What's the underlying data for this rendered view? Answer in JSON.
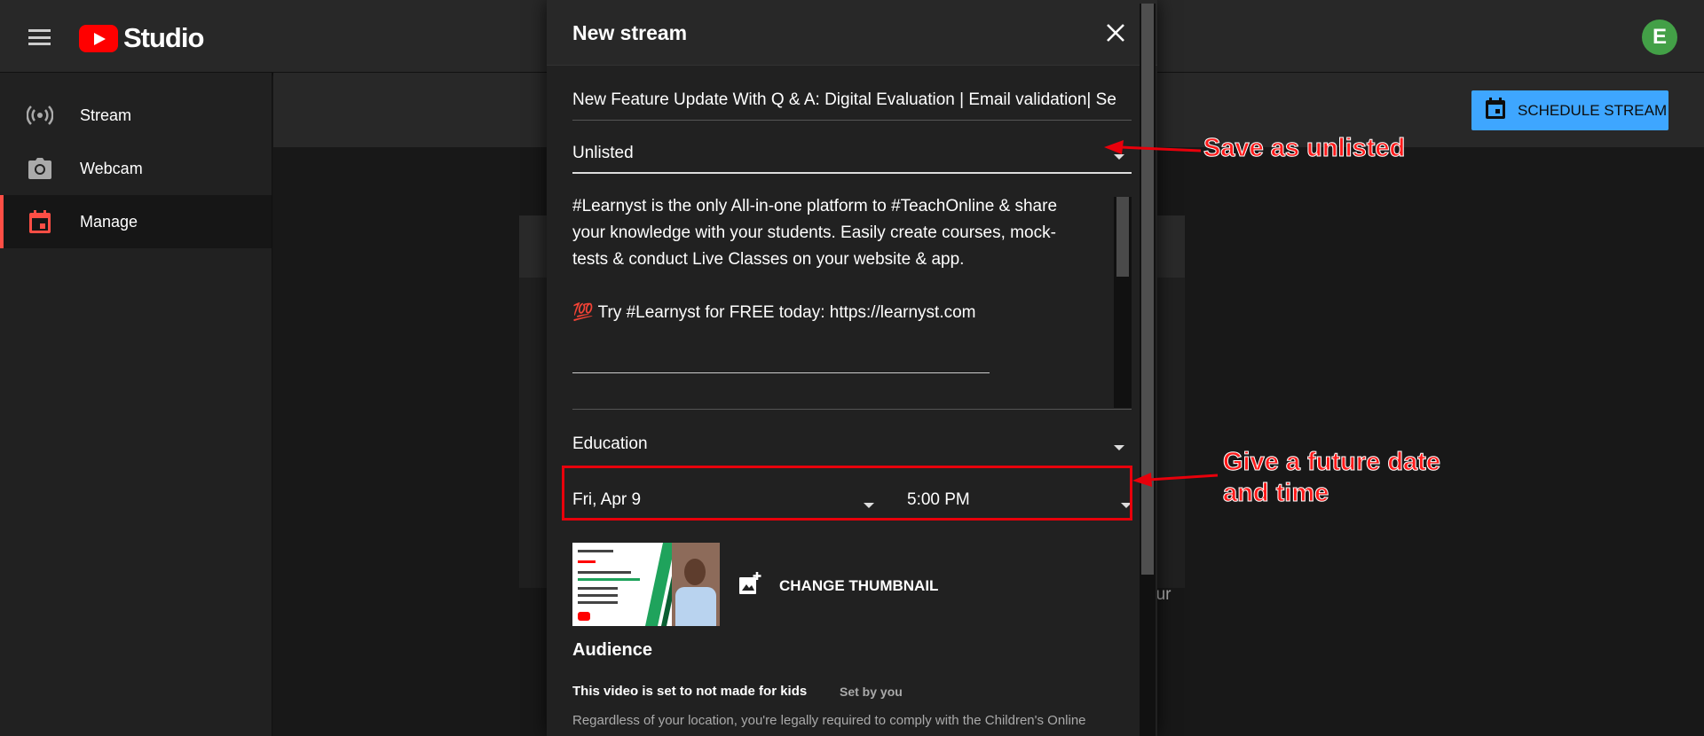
{
  "app": {
    "logo_text": "Studio",
    "avatar_letter": "E"
  },
  "sidebar": {
    "items": [
      {
        "label": "Stream",
        "icon": "broadcast-icon"
      },
      {
        "label": "Webcam",
        "icon": "camera-icon"
      },
      {
        "label": "Manage",
        "icon": "calendar-icon"
      }
    ],
    "active": "Manage"
  },
  "header": {
    "schedule_button": "SCHEDULE STREAM"
  },
  "background": {
    "partial_text": "our"
  },
  "dialog": {
    "title": "New stream",
    "stream_title": "New Feature Update With Q & A: Digital Evaluation | Email validation| Se",
    "visibility": "Unlisted",
    "description": {
      "line1": "#Learnyst is the only All-in-one platform to #TeachOnline & share",
      "line2": "your knowledge with your students. Easily create courses, mock-",
      "line3": "tests & conduct Live Classes on your website & app.",
      "line5": "💯 Try #Learnyst for FREE today: https://learnyst.com"
    },
    "category": "Education",
    "date": "Fri, Apr 9",
    "time": "5:00 PM",
    "change_thumbnail": "CHANGE THUMBNAIL",
    "audience": {
      "title": "Audience",
      "status": "This video is set to not made for kids",
      "set_by": "Set by you",
      "description": "Regardless of your location, you're legally required to comply with the Children's Online"
    }
  },
  "annotations": {
    "unlisted_note": "Save as unlisted",
    "datetime_note_line1": "Give a future date",
    "datetime_note_line2": "and time",
    "color": "#e8000b"
  },
  "colors": {
    "accent_blue": "#3ea6ff",
    "brand_red": "#ff0000",
    "active_marker": "#ff4e45",
    "avatar_green": "#43a047"
  }
}
